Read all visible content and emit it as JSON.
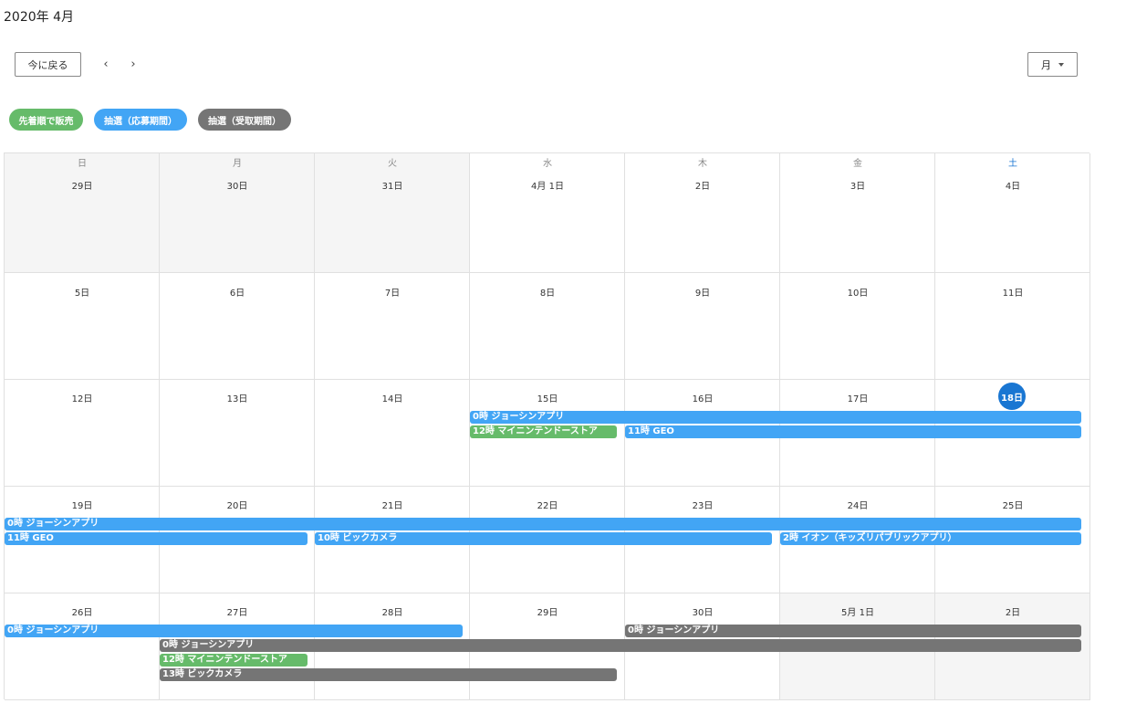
{
  "header": {
    "title": "2020年 4月",
    "today_label": "今に戻る",
    "prev_label": "‹",
    "next_label": "›",
    "view_label": "月"
  },
  "legend": [
    {
      "label": "先着順で販売",
      "color": "#66bb6a"
    },
    {
      "label": "抽選（応募期間）",
      "color": "#42a5f5"
    },
    {
      "label": "抽選（受取期間）",
      "color": "#757575"
    }
  ],
  "weekdays": [
    "日",
    "月",
    "火",
    "水",
    "木",
    "金",
    "土"
  ],
  "weeks": [
    [
      "29日",
      "30日",
      "31日",
      "4月 1日",
      "2日",
      "3日",
      "4日"
    ],
    [
      "5日",
      "6日",
      "7日",
      "8日",
      "9日",
      "10日",
      "11日"
    ],
    [
      "12日",
      "13日",
      "14日",
      "15日",
      "16日",
      "17日",
      "18日"
    ],
    [
      "19日",
      "20日",
      "21日",
      "22日",
      "23日",
      "24日",
      "25日"
    ],
    [
      "26日",
      "27日",
      "28日",
      "29日",
      "30日",
      "5月 1日",
      "2日"
    ]
  ],
  "today_label": "18日",
  "events": {
    "w3_joshin": "0時 ジョーシンアプリ",
    "w3_nintendo": "12時 マイニンテンドーストア",
    "w3_geo": "11時 GEO",
    "w4_joshin": "0時 ジョーシンアプリ",
    "w4_geo": "11時 GEO",
    "w4_bic": "10時 ビックカメラ",
    "w4_aeon": "2時 イオン（キッズリパブリックアプリ）",
    "w5_joshin_blue": "0時 ジョーシンアプリ",
    "w5_joshin_gray1": "0時 ジョーシンアプリ",
    "w5_joshin_gray2": "0時 ジョーシンアプリ",
    "w5_nintendo": "12時 マイニンテンドーストア",
    "w5_bic": "13時 ビックカメラ"
  },
  "colors": {
    "green": "#66bb6a",
    "blue": "#42a5f5",
    "gray": "#757575",
    "today": "#1976d2"
  }
}
